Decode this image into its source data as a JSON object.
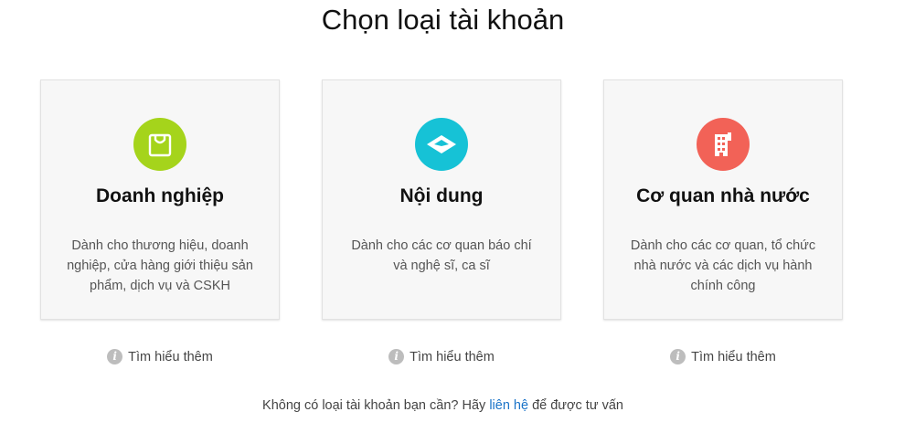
{
  "page": {
    "title": "Chọn loại tài khoản"
  },
  "cards": [
    {
      "title": "Doanh nghiệp",
      "description": "Dành cho thương hiệu, doanh nghiệp, cửa hàng giới thiệu sản phẩm, dịch vụ và CSKH",
      "icon": "shopping-bag-icon",
      "icon_color": "#a5d41b",
      "learn_more": "Tìm hiểu thêm"
    },
    {
      "title": "Nội dung",
      "description": "Dành cho các cơ quan báo chí và nghệ sĩ, ca sĩ",
      "icon": "content-icon",
      "icon_color": "#16c2d6",
      "learn_more": "Tìm hiểu thêm"
    },
    {
      "title": "Cơ quan nhà nước",
      "description": "Dành cho các cơ quan, tổ chức nhà nước và các dịch vụ hành chính công",
      "icon": "building-icon",
      "icon_color": "#f26257",
      "learn_more": "Tìm hiểu thêm"
    }
  ],
  "footer": {
    "prefix": "Không có loại tài khoản bạn cần? Hãy ",
    "link": "liên hệ",
    "suffix": " để được tư vấn",
    "link_color": "#1a73c8"
  },
  "info_icon_glyph": "i"
}
